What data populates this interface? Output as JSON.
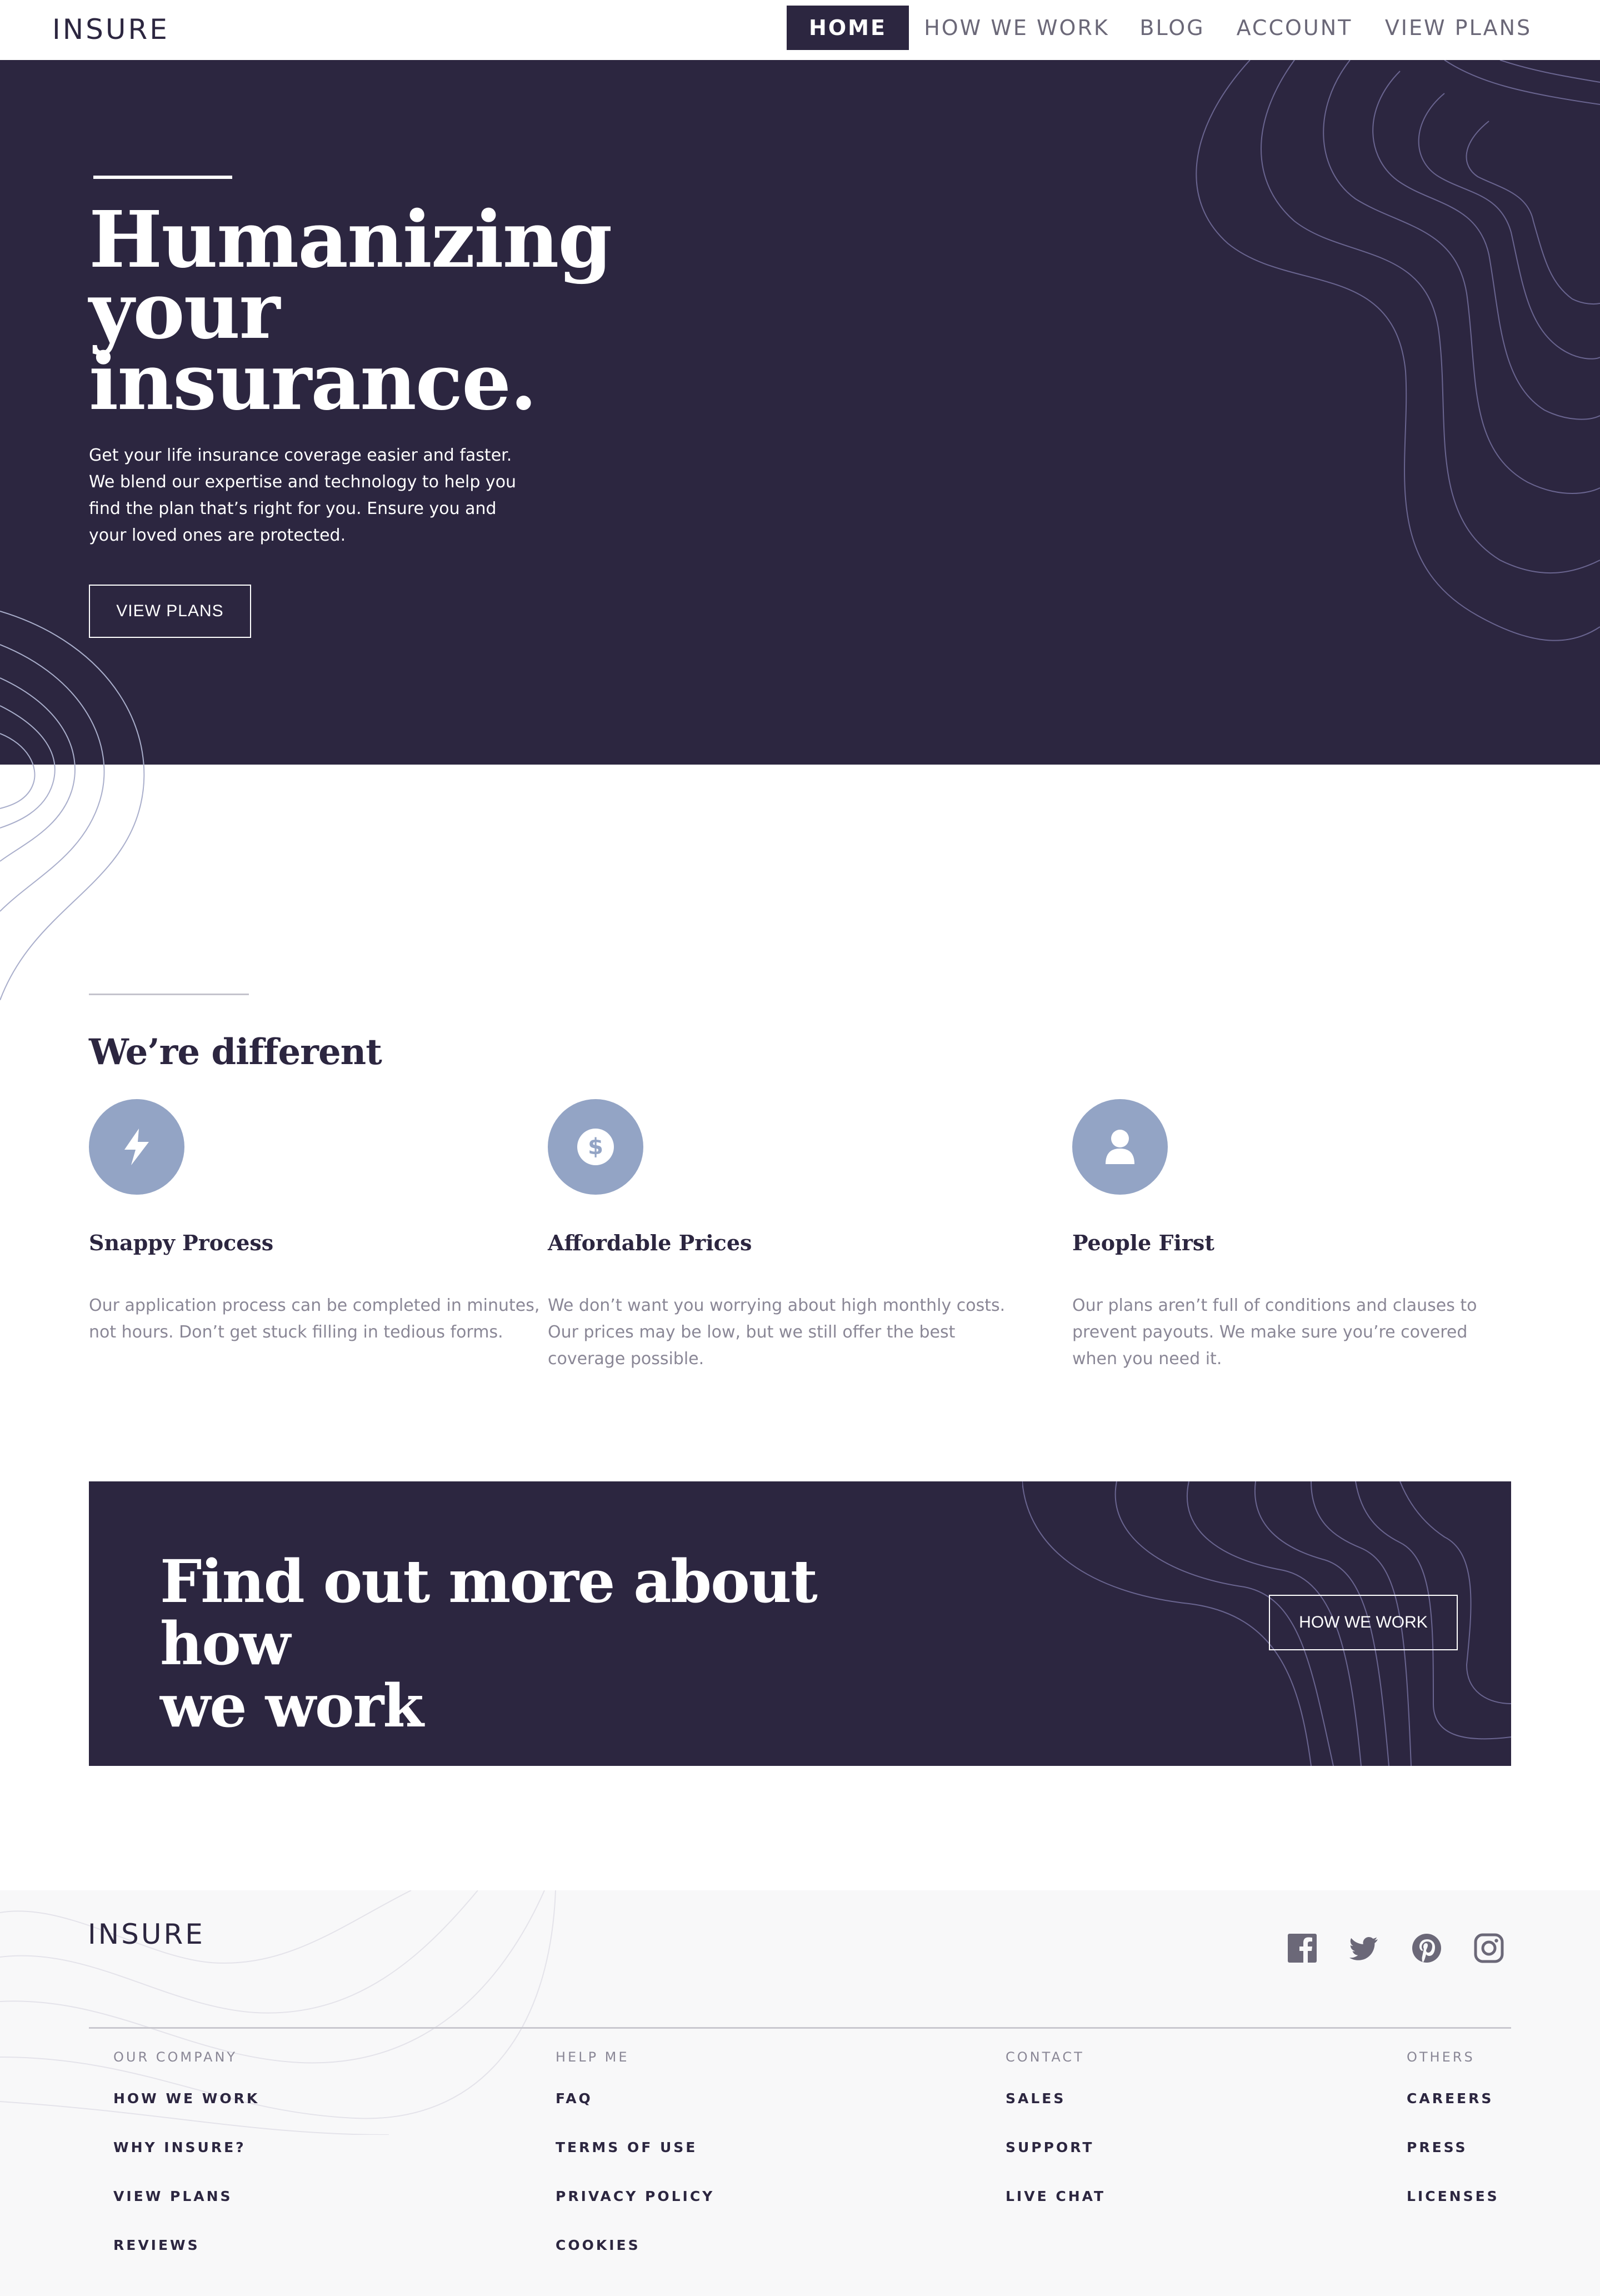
{
  "brand": {
    "logo": "INSURE"
  },
  "nav": {
    "items": [
      {
        "label": "HOME",
        "active": true
      },
      {
        "label": "HOW WE WORK"
      },
      {
        "label": "BLOG"
      },
      {
        "label": "ACCOUNT"
      },
      {
        "label": "VIEW PLANS"
      }
    ]
  },
  "hero": {
    "title_lines": [
      "Humanizing",
      "your",
      "insurance."
    ],
    "text": "Get your life insurance coverage easier and faster. We blend our expertise and technology to help you find the plan that’s right for you. Ensure you and your loved ones are protected.",
    "cta": "VIEW PLANS"
  },
  "different": {
    "title": "We’re different",
    "features": [
      {
        "icon": "lightning-icon",
        "title": "Snappy Process",
        "text": "Our application process can be completed in minutes, not hours. Don’t get stuck filling in tedious forms."
      },
      {
        "icon": "dollar-icon",
        "title": "Affordable Prices",
        "text": "We don’t want you worrying about high monthly costs. Our prices may be low, but we still offer the best coverage possible."
      },
      {
        "icon": "person-icon",
        "title": "People First",
        "text": "Our plans aren’t full of conditions and clauses to prevent payouts. We make sure you’re covered when you need it."
      }
    ]
  },
  "cta_band": {
    "title_lines": [
      "Find out more about how",
      "we work"
    ],
    "button": "HOW WE WORK"
  },
  "footer": {
    "logo": "INSURE",
    "social": [
      "facebook-icon",
      "twitter-icon",
      "pinterest-icon",
      "instagram-icon"
    ],
    "columns": [
      {
        "heading": "OUR COMPANY",
        "links": [
          "HOW WE WORK",
          "WHY INSURE?",
          "VIEW PLANS",
          "REVIEWS"
        ]
      },
      {
        "heading": "HELP ME",
        "links": [
          "FAQ",
          "TERMS OF USE",
          "PRIVACY POLICY",
          "COOKIES"
        ]
      },
      {
        "heading": "CONTACT",
        "links": [
          "SALES",
          "SUPPORT",
          "LIVE CHAT"
        ]
      },
      {
        "heading": "OTHERS",
        "links": [
          "CAREERS",
          "PRESS",
          "LICENSES"
        ]
      }
    ]
  },
  "colors": {
    "primary": "#2c2640",
    "icon_bg": "#93a4c5",
    "muted_text": "#8a8796",
    "footer_bg": "#f8f8f9"
  }
}
